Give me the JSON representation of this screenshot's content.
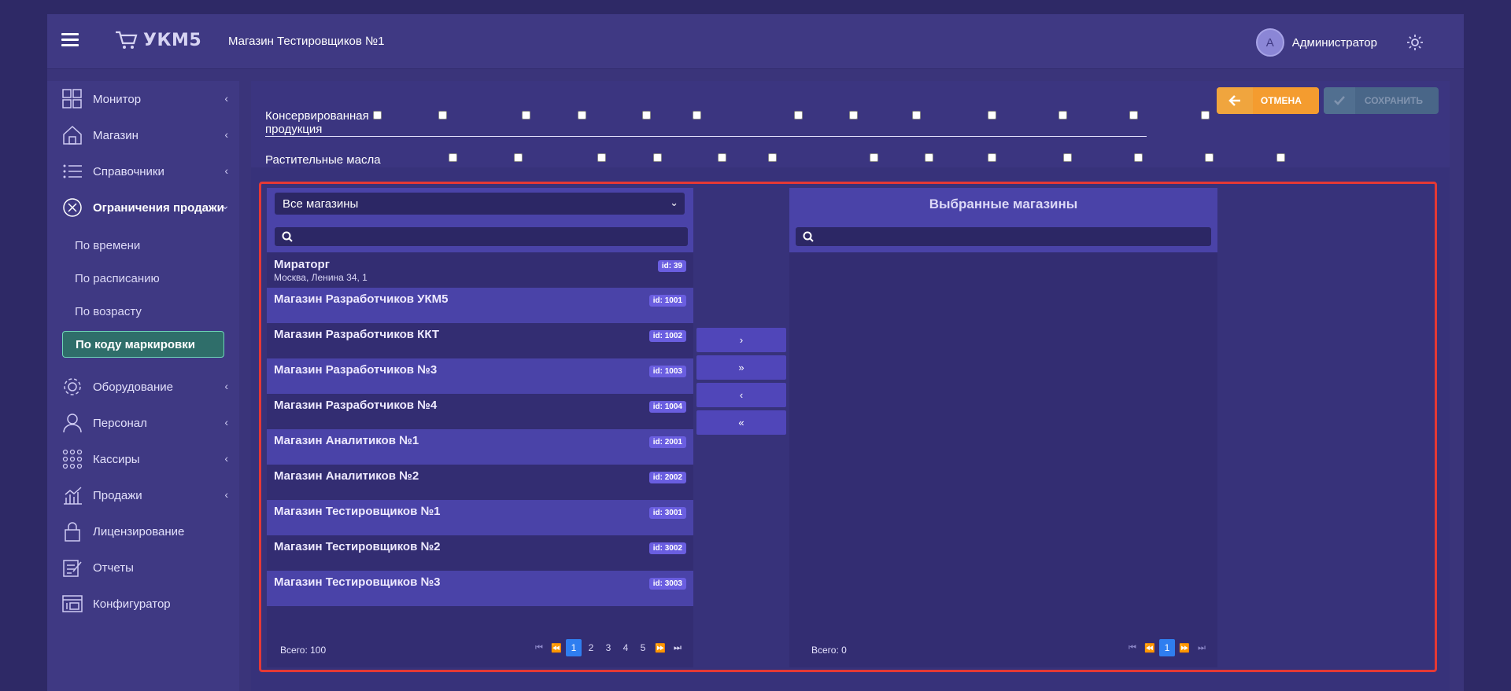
{
  "header": {
    "logo_text": "УКМ5",
    "store_title": "Магазин Тестировщиков №1",
    "avatar_letter": "A",
    "user_name": "Администратор"
  },
  "sidebar": {
    "items": [
      {
        "label": "Монитор",
        "icon": "monitor-icon"
      },
      {
        "label": "Магазин",
        "icon": "shop-icon"
      },
      {
        "label": "Справочники",
        "icon": "list-icon"
      },
      {
        "label": "Ограничения продажи",
        "icon": "restriction-icon"
      },
      {
        "label": "Оборудование",
        "icon": "gear-icon"
      },
      {
        "label": "Персонал",
        "icon": "person-icon"
      },
      {
        "label": "Кассиры",
        "icon": "dots-grid-icon"
      },
      {
        "label": "Продажи",
        "icon": "chart-icon"
      },
      {
        "label": "Лицензирование",
        "icon": "lock-icon"
      },
      {
        "label": "Отчеты",
        "icon": "report-icon"
      },
      {
        "label": "Конфигуратор",
        "icon": "configurator-icon"
      }
    ],
    "sub_items": [
      "По времени",
      "По расписанию",
      "По возрасту",
      "По коду маркировки"
    ]
  },
  "toolbar": {
    "cancel_label": "ОТМЕНА",
    "save_label": "СОХРАНИТЬ"
  },
  "products": {
    "row1": "Консервированная продукция",
    "row2": "Растительные масла"
  },
  "left_panel": {
    "select_value": "Все магазины",
    "stores": [
      {
        "name": "Мираторг",
        "address": "Москва, Ленина 34, 1",
        "id": "id: 39"
      },
      {
        "name": "Магазин Разработчиков УКМ5",
        "id": "id: 1001"
      },
      {
        "name": "Магазин Разработчиков ККТ",
        "id": "id: 1002"
      },
      {
        "name": "Магазин Разработчиков №3",
        "id": "id: 1003"
      },
      {
        "name": "Магазин Разработчиков №4",
        "id": "id: 1004"
      },
      {
        "name": "Магазин Аналитиков №1",
        "id": "id: 2001"
      },
      {
        "name": "Магазин Аналитиков №2",
        "id": "id: 2002"
      },
      {
        "name": "Магазин Тестировщиков №1",
        "id": "id: 3001"
      },
      {
        "name": "Магазин Тестировщиков №2",
        "id": "id: 3002"
      },
      {
        "name": "Магазин Тестировщиков №3",
        "id": "id: 3003"
      }
    ],
    "total": "Всего: 100",
    "pages": [
      "1",
      "2",
      "3",
      "4",
      "5"
    ]
  },
  "right_panel": {
    "title": "Выбранные магазины",
    "total": "Всего: 0",
    "pages": [
      "1"
    ]
  }
}
